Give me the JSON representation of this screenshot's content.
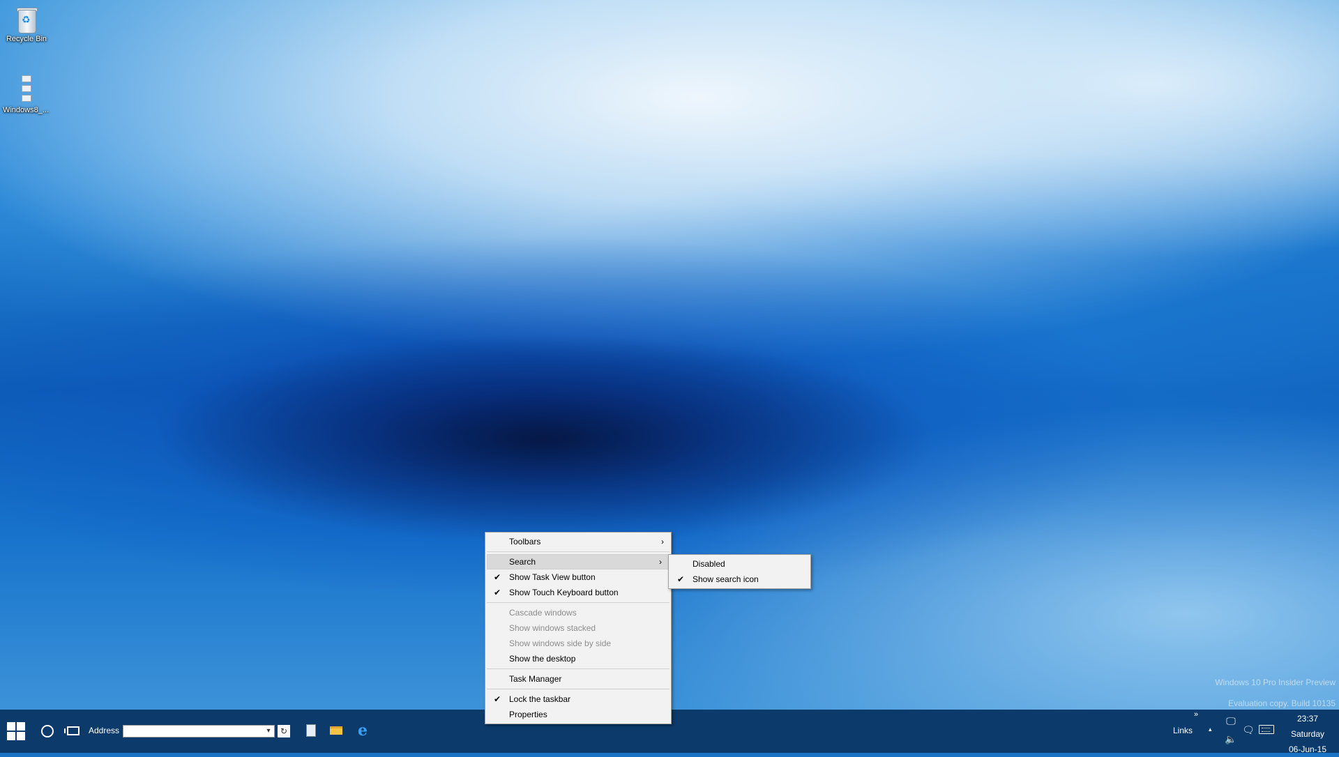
{
  "desktop": {
    "icons": [
      {
        "label": "Recycle Bin",
        "icon": "recycle-bin-icon"
      },
      {
        "label": "Windows8_...",
        "icon": "zip-archive-icon"
      }
    ],
    "watermark": {
      "line1": "Windows 10 Pro Insider Preview",
      "line2": "Evaluation copy. Build 10135"
    }
  },
  "context_menu": {
    "items": {
      "toolbars": {
        "label": "Toolbars",
        "has_submenu": true
      },
      "search": {
        "label": "Search",
        "has_submenu": true,
        "highlighted": true
      },
      "task_view": {
        "label": "Show Task View button",
        "checked": true
      },
      "touch_keyboard": {
        "label": "Show Touch Keyboard button",
        "checked": true
      },
      "cascade": {
        "label": "Cascade windows",
        "enabled": false
      },
      "stacked": {
        "label": "Show windows stacked",
        "enabled": false
      },
      "side_by_side": {
        "label": "Show windows side by side",
        "enabled": false
      },
      "show_desktop": {
        "label": "Show the desktop"
      },
      "task_manager": {
        "label": "Task Manager"
      },
      "lock_taskbar": {
        "label": "Lock the taskbar",
        "checked": true
      },
      "properties": {
        "label": "Properties"
      }
    },
    "check_glyph": "✔",
    "arrow_glyph": "›"
  },
  "search_submenu": {
    "disabled": {
      "label": "Disabled",
      "checked": false
    },
    "show_icon": {
      "label": "Show search icon",
      "checked": true
    }
  },
  "taskbar": {
    "address_label": "Address",
    "address_value": "",
    "dropdown_glyph": "▾",
    "refresh_glyph": "↻",
    "ie_glyph": "e",
    "links_label": "Links",
    "links_chevron": "»",
    "tray_overflow_glyph": "▴",
    "network_glyph": "🖵",
    "volume_glyph": "🔈",
    "action_center_glyph": "🗨",
    "clock": {
      "time": "23:37",
      "day": "Saturday",
      "date": "06-Jun-15"
    }
  },
  "colors": {
    "taskbar": "#0c3a6b",
    "menu_bg": "#f2f2f2",
    "menu_highlight": "#d9d9d9",
    "disabled_text": "#8c8c8c"
  }
}
